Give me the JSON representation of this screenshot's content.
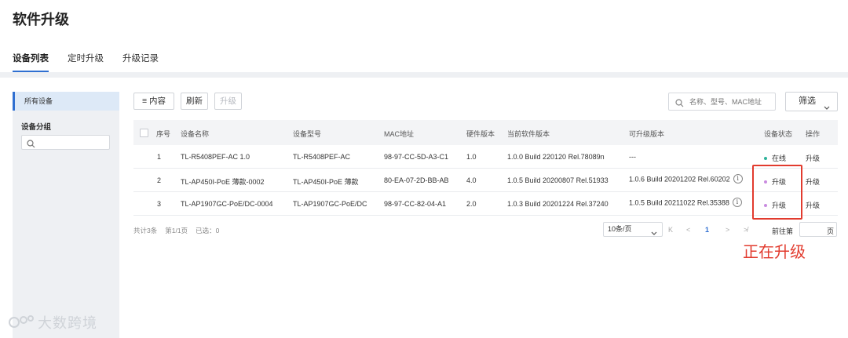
{
  "page": {
    "title": "软件升级"
  },
  "tabs": [
    {
      "label": "设备列表",
      "active": true
    },
    {
      "label": "定时升级",
      "active": false
    },
    {
      "label": "升级记录",
      "active": false
    }
  ],
  "sidebar": {
    "selected_item": "所有设备",
    "group_label": "设备分组",
    "search_placeholder": ""
  },
  "toolbar": {
    "content_label": "≡ 内容",
    "refresh_label": "刷新",
    "upgrade_label": "升级",
    "search_placeholder": "名称、型号、MAC地址",
    "filter_label": "筛选"
  },
  "table": {
    "columns": [
      "序号",
      "设备名称",
      "设备型号",
      "MAC地址",
      "硬件版本",
      "当前软件版本",
      "可升级版本",
      "设备状态",
      "操作"
    ],
    "rows": [
      {
        "index": "1",
        "name": "TL-R5408PEF-AC 1.0",
        "model": "TL-R5408PEF-AC",
        "mac": "98-97-CC-5D-A3-C1",
        "hw": "1.0",
        "current_sw": "1.0.0 Build 220120 Rel.78089n",
        "upgradable": "---",
        "status": "在线",
        "status_color": "#2db39a",
        "action": "升级"
      },
      {
        "index": "2",
        "name": "TL-AP450I-PoE 薄款-0002",
        "model": "TL-AP450I-PoE 薄款",
        "mac": "80-EA-07-2D-BB-AB",
        "hw": "4.0",
        "current_sw": "1.0.5 Build 20200807 Rel.51933",
        "upgradable": "1.0.6 Build 20201202 Rel.60202",
        "status": "升级",
        "status_color": "#c98be0",
        "action": "升级"
      },
      {
        "index": "3",
        "name": "TL-AP1907GC-PoE/DC-0004",
        "model": "TL-AP1907GC-PoE/DC",
        "mac": "98-97-CC-82-04-A1",
        "hw": "2.0",
        "current_sw": "1.0.3 Build 20201224 Rel.37240",
        "upgradable": "1.0.5 Build 20211022 Rel.35388",
        "status": "升级",
        "status_color": "#c98be0",
        "action": "升级"
      }
    ]
  },
  "footer": {
    "total": "共计3条",
    "page_info": "第1/1页",
    "selected": "已选：0",
    "page_size": "10条/页",
    "first": "K",
    "prev": "<",
    "current_page": "1",
    "next": ">",
    "last": "≯",
    "goto_label": "前往第",
    "goto_unit": "页"
  },
  "annotation": {
    "text": "正在升级",
    "color": "#e23b2e"
  },
  "watermark": {
    "text": "大数跨境"
  },
  "icons": {
    "search": "search-icon",
    "chevron": "chevron-down-icon",
    "info": "info-icon"
  },
  "colors": {
    "accent": "#2f6fd1",
    "online": "#2db39a",
    "upgrading": "#c98be0",
    "annotation": "#e23b2e"
  }
}
